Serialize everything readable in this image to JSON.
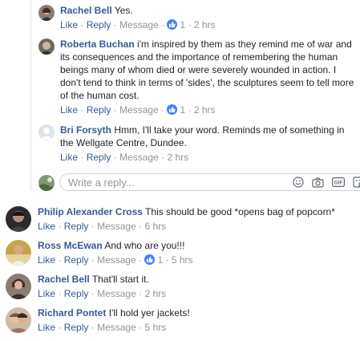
{
  "labels": {
    "like": "Like",
    "reply": "Reply",
    "message": "Message",
    "sep": "·"
  },
  "reply_box": {
    "placeholder": "Write a reply..."
  },
  "nested_comments": [
    {
      "author": "Rachel Bell",
      "text": "Yes.",
      "likes": "1",
      "time": "2 hrs"
    },
    {
      "author": "Roberta Buchan",
      "text": "i'm inspired by them as they remind me of war and its consequences and the importance of remembering the human beings many of whom died or were severely wounded in action. I don't tend to think in terms of 'sides', the sculptures seem to tell more of the human cost.",
      "likes": "1",
      "time": "2 hrs"
    },
    {
      "author": "Bri Forsyth",
      "text": "Hmm, I'll take your word. Reminds me of something in the Wellgate Centre, Dundee.",
      "likes": "",
      "time": "2 hrs"
    }
  ],
  "top_comments": [
    {
      "author": "Philip Alexander Cross",
      "text": "This should be good *opens bag of popcorn*",
      "likes": "",
      "time": "6 hrs"
    },
    {
      "author": "Ross McEwan",
      "text": "And who are you!!!",
      "likes": "1",
      "time": "5 hrs"
    },
    {
      "author": "Rachel Bell",
      "text": "That'll start it.",
      "likes": "",
      "time": "2 hrs"
    },
    {
      "author": "Richard Pontet",
      "text": "I'll hold yer jackets!",
      "likes": "",
      "time": "5 hrs"
    }
  ],
  "icons": [
    "thumbs-up-icon",
    "emoji-icon",
    "camera-icon",
    "gif-icon",
    "sticker-icon"
  ],
  "colors": {
    "link": "#385898",
    "meta": "#90949c",
    "like_badge": "#4080ff",
    "border": "#ccd0d5"
  }
}
